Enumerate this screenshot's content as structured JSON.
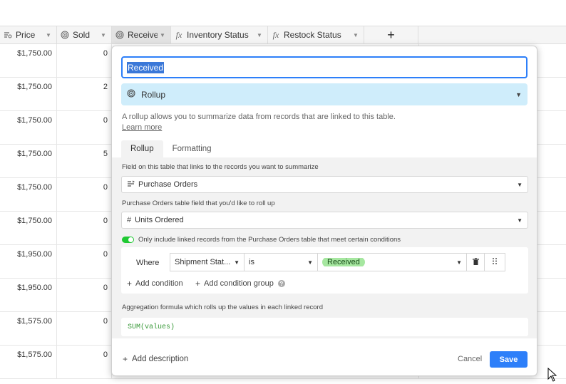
{
  "columns": [
    {
      "label": "Price",
      "icon": "currency-icon"
    },
    {
      "label": "Sold",
      "icon": "rollup-icon"
    },
    {
      "label": "Received",
      "icon": "rollup-icon"
    },
    {
      "label": "Inventory Status",
      "icon": "formula-icon"
    },
    {
      "label": "Restock Status",
      "icon": "formula-icon"
    }
  ],
  "add_field_label": "+",
  "rows": [
    {
      "price": "$1,750.00",
      "sold": "0"
    },
    {
      "price": "$1,750.00",
      "sold": "2"
    },
    {
      "price": "$1,750.00",
      "sold": "0"
    },
    {
      "price": "$1,750.00",
      "sold": "5"
    },
    {
      "price": "$1,750.00",
      "sold": "0"
    },
    {
      "price": "$1,750.00",
      "sold": "0"
    },
    {
      "price": "$1,950.00",
      "sold": "0"
    },
    {
      "price": "$1,950.00",
      "sold": "0"
    },
    {
      "price": "$1,575.00",
      "sold": "0"
    },
    {
      "price": "$1,575.00",
      "sold": "0"
    }
  ],
  "modal": {
    "field_name": "Received",
    "field_type": "Rollup",
    "description": "A rollup allows you to summarize data from records that are linked to this table.",
    "learn_more": "Learn more",
    "tabs": [
      "Rollup",
      "Formatting"
    ],
    "link_field_label": "Field on this table that links to the records you want to summarize",
    "link_field_value": "Purchase Orders",
    "rollup_field_label": "Purchase Orders table field that you'd like to roll up",
    "rollup_field_value": "Units Ordered",
    "condition_toggle_label": "Only include linked records from the Purchase Orders table that meet certain conditions",
    "condition": {
      "where": "Where",
      "field": "Shipment Stat...",
      "operator": "is",
      "value": "Received"
    },
    "add_condition": "Add condition",
    "add_condition_group": "Add condition group",
    "aggregation_label": "Aggregation formula which rolls up the values in each linked record",
    "formula": "SUM(values)",
    "add_description": "Add description",
    "cancel": "Cancel",
    "save": "Save"
  },
  "colors": {
    "accent": "#2d7ff9",
    "type_bg": "#cfedfb",
    "toggle_on": "#20c933",
    "chip_bg": "#a6e7a0"
  }
}
